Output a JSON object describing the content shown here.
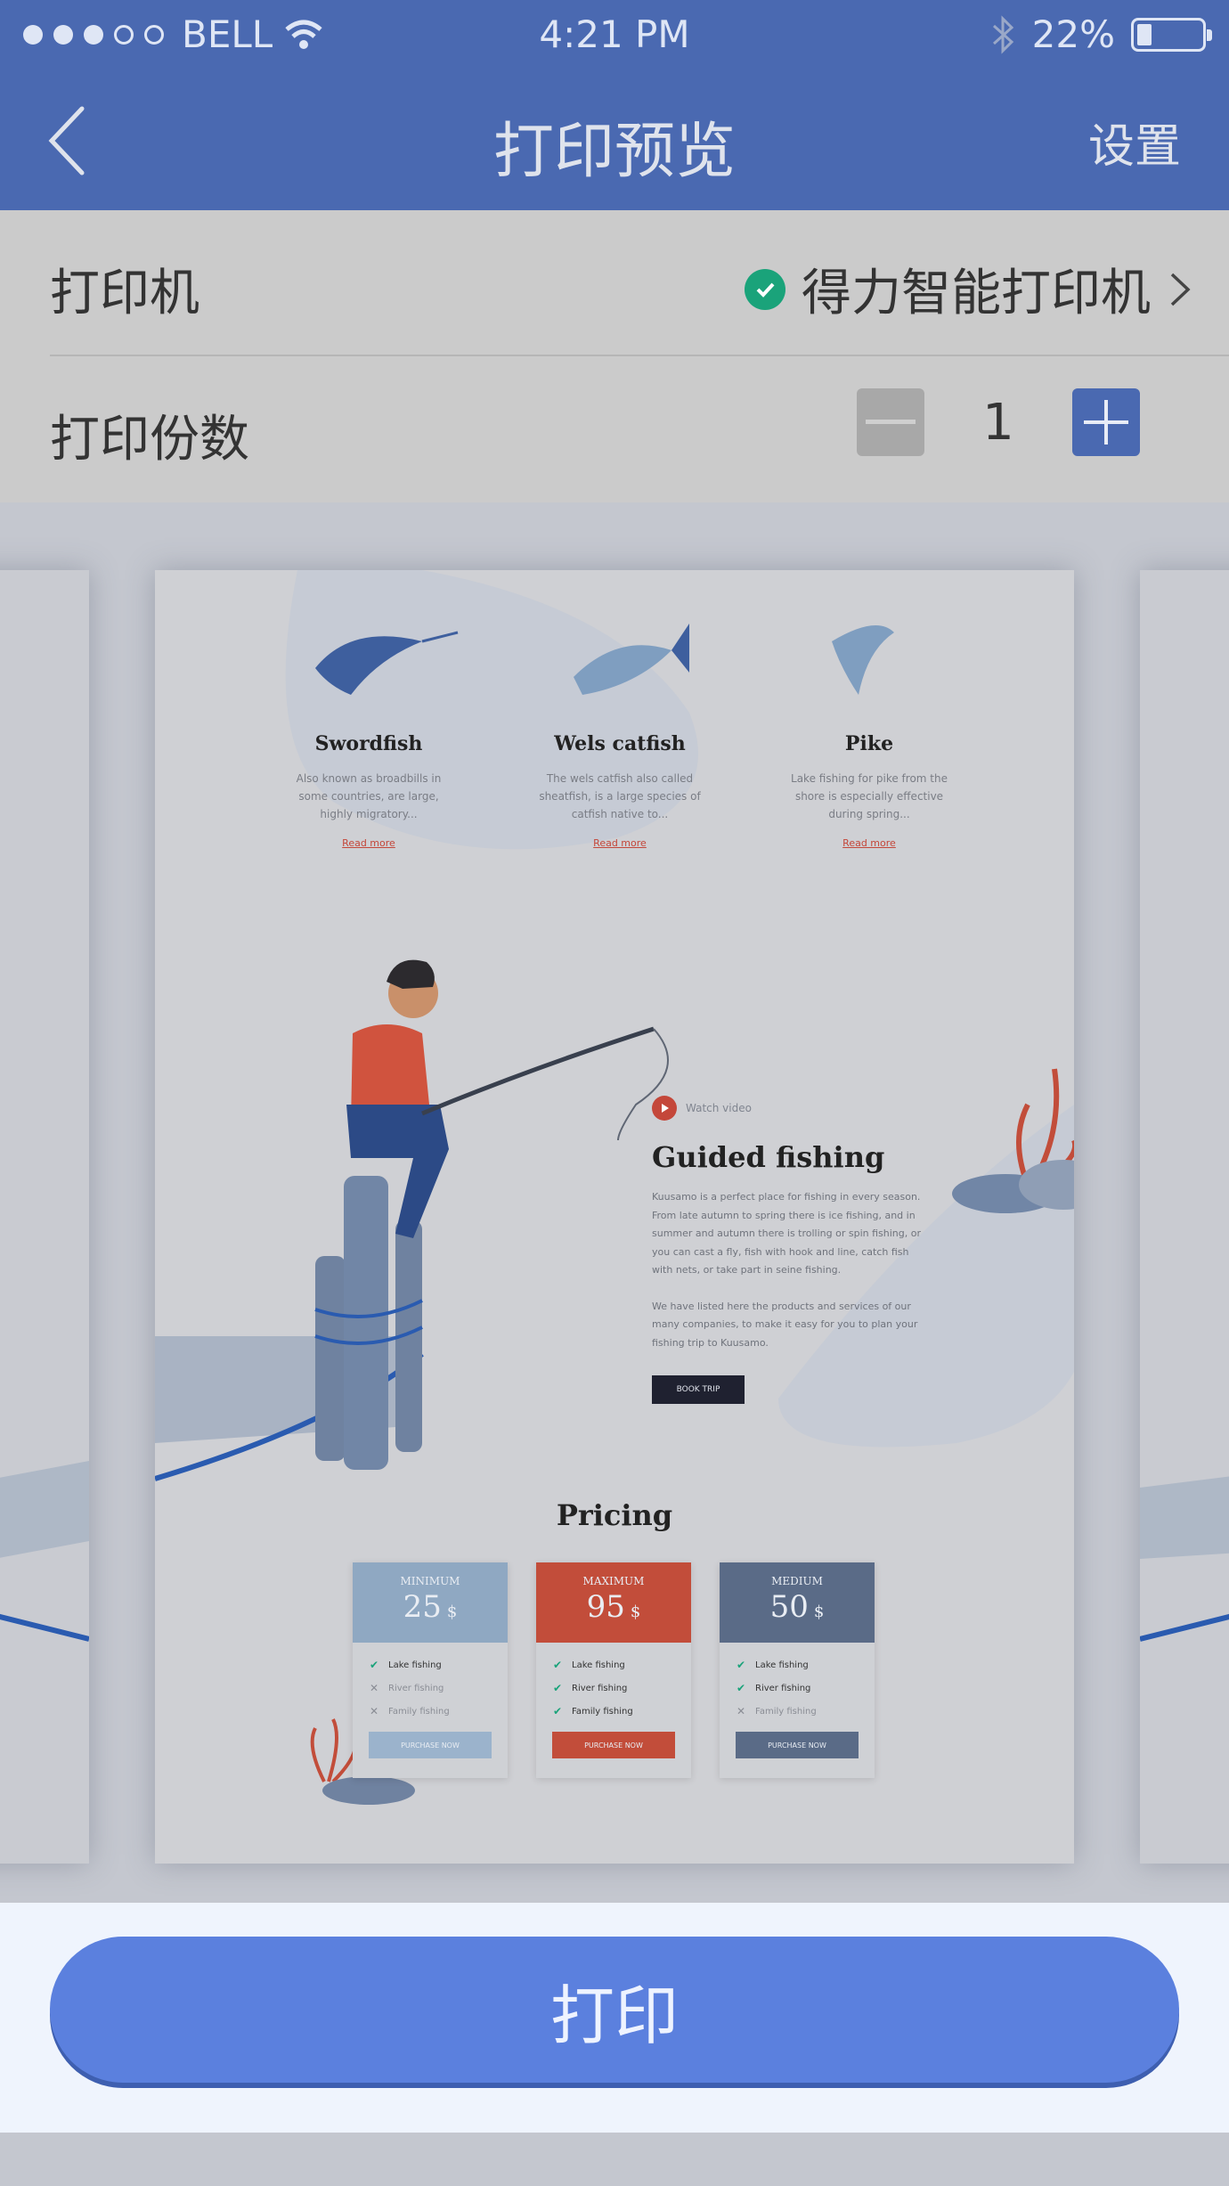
{
  "status_bar": {
    "carrier": "BELL",
    "time": "4:21 PM",
    "battery": "22%"
  },
  "nav": {
    "title": "打印预览",
    "settings_label": "设置"
  },
  "printer_row": {
    "label": "打印机",
    "value": "得力智能打印机"
  },
  "copies_row": {
    "label": "打印份数",
    "quantity": "1"
  },
  "preview": {
    "fish": [
      {
        "name": "Swordfish",
        "desc": "Also known as broadbills in some countries, are large, highly migratory...",
        "link": "Read more"
      },
      {
        "name": "Wels catfish",
        "desc": "The wels catfish also called sheatfish, is a large species of catfish native to...",
        "link": "Read more"
      },
      {
        "name": "Pike",
        "desc": "Lake fishing for pike from the shore is especially effective during spring...",
        "link": "Read more"
      }
    ],
    "watch_video": "Watch video",
    "guided_title": "Guided fishing",
    "guided_p1": "Kuusamo is a perfect place for fishing in every season. From late autumn to spring there is ice fishing, and in summer and autumn there is trolling or spin fishing, or you can cast a fly, fish with hook and line, catch fish with nets, or take part in seine fishing.",
    "guided_p2": "We have listed here the products and services of our many companies, to make it easy for you to plan your fishing trip to Kuusamo.",
    "book_trip": "BOOK TRIP",
    "pricing_title": "Pricing",
    "plans": [
      {
        "tier": "MINIMUM",
        "price": "25",
        "currency": "$",
        "color": "#8fa8c2",
        "button": "PURCHASE NOW",
        "button_color": "#9bb3cc",
        "features": [
          {
            "text": "Lake fishing",
            "on": true
          },
          {
            "text": "River fishing",
            "on": false
          },
          {
            "text": "Family fishing",
            "on": false
          }
        ]
      },
      {
        "tier": "MAXIMUM",
        "price": "95",
        "currency": "$",
        "color": "#c24d3a",
        "button": "PURCHASE NOW",
        "button_color": "#c24d3a",
        "features": [
          {
            "text": "Lake fishing",
            "on": true
          },
          {
            "text": "River fishing",
            "on": true
          },
          {
            "text": "Family fishing",
            "on": true
          }
        ]
      },
      {
        "tier": "MEDIUM",
        "price": "50",
        "currency": "$",
        "color": "#5a6b87",
        "button": "PURCHASE NOW",
        "button_color": "#5a6b87",
        "features": [
          {
            "text": "Lake fishing",
            "on": true
          },
          {
            "text": "River fishing",
            "on": true
          },
          {
            "text": "Family fishing",
            "on": false
          }
        ]
      }
    ]
  },
  "print_button": "打印",
  "colors": {
    "nav": "#4a69b1",
    "accent": "#5b80de",
    "check": "#1aa37a"
  }
}
